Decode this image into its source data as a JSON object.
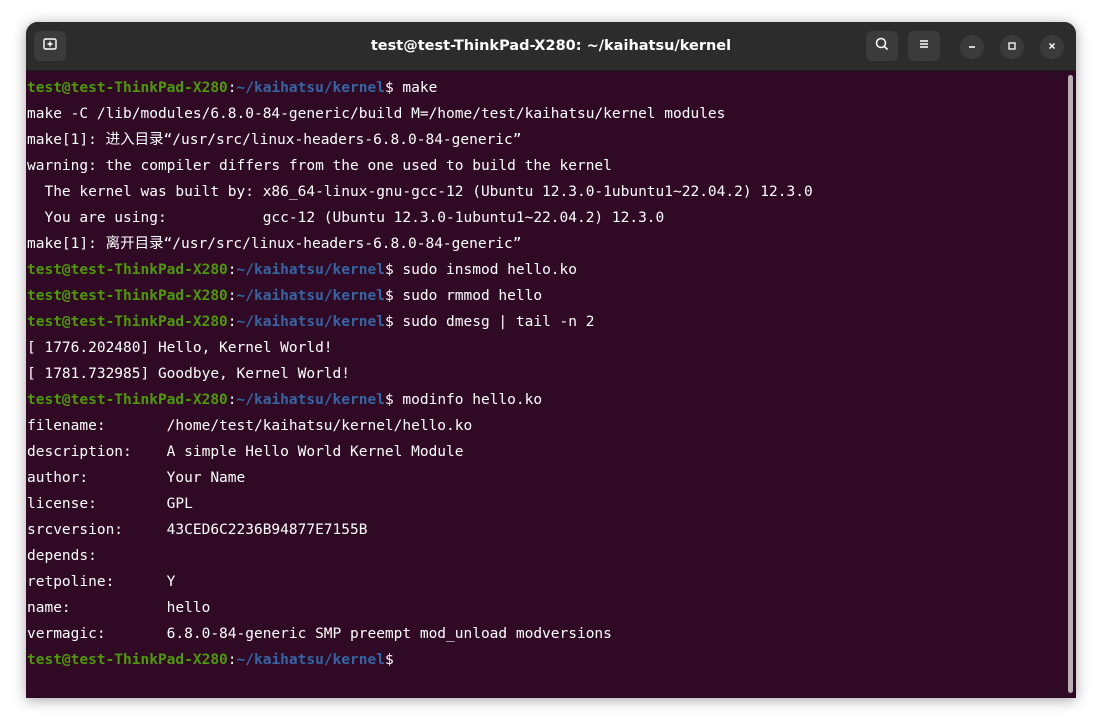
{
  "window": {
    "title": "test@test-ThinkPad-X280: ~/kaihatsu/kernel"
  },
  "titlebar": {
    "new_tab_icon": "new-tab-icon",
    "search_icon": "search-icon",
    "menu_icon": "hamburger-menu-icon",
    "minimize_icon": "minimize-icon",
    "maximize_icon": "maximize-icon",
    "close_icon": "close-icon"
  },
  "colors": {
    "terminal_bg": "#300a24",
    "prompt_user": "#4e9a06",
    "prompt_path": "#3465a4",
    "titlebar_bg": "#2c2c2c"
  },
  "terminal": {
    "prompt": {
      "user": "test@test-ThinkPad-X280",
      "colon": ":",
      "path": "~/kaihatsu/kernel",
      "dollar": "$ "
    },
    "lines": [
      {
        "type": "prompt",
        "cmd": "make"
      },
      {
        "type": "out",
        "text": "make -C /lib/modules/6.8.0-84-generic/build M=/home/test/kaihatsu/kernel modules"
      },
      {
        "type": "out",
        "text": "make[1]: 进入目录“/usr/src/linux-headers-6.8.0-84-generic”"
      },
      {
        "type": "out",
        "text": "warning: the compiler differs from the one used to build the kernel"
      },
      {
        "type": "out",
        "text": "  The kernel was built by: x86_64-linux-gnu-gcc-12 (Ubuntu 12.3.0-1ubuntu1~22.04.2) 12.3.0"
      },
      {
        "type": "out",
        "text": "  You are using:           gcc-12 (Ubuntu 12.3.0-1ubuntu1~22.04.2) 12.3.0"
      },
      {
        "type": "out",
        "text": "make[1]: 离开目录“/usr/src/linux-headers-6.8.0-84-generic”"
      },
      {
        "type": "prompt",
        "cmd": "sudo insmod hello.ko"
      },
      {
        "type": "prompt",
        "cmd": "sudo rmmod hello"
      },
      {
        "type": "prompt",
        "cmd": "sudo dmesg | tail -n 2"
      },
      {
        "type": "out",
        "text": "[ 1776.202480] Hello, Kernel World!"
      },
      {
        "type": "out",
        "text": "[ 1781.732985] Goodbye, Kernel World!"
      },
      {
        "type": "prompt",
        "cmd": "modinfo hello.ko"
      },
      {
        "type": "out",
        "text": "filename:       /home/test/kaihatsu/kernel/hello.ko"
      },
      {
        "type": "out",
        "text": "description:    A simple Hello World Kernel Module"
      },
      {
        "type": "out",
        "text": "author:         Your Name"
      },
      {
        "type": "out",
        "text": "license:        GPL"
      },
      {
        "type": "out",
        "text": "srcversion:     43CED6C2236B94877E7155B"
      },
      {
        "type": "out",
        "text": "depends:        "
      },
      {
        "type": "out",
        "text": "retpoline:      Y"
      },
      {
        "type": "out",
        "text": "name:           hello"
      },
      {
        "type": "out",
        "text": "vermagic:       6.8.0-84-generic SMP preempt mod_unload modversions"
      },
      {
        "type": "prompt",
        "cmd": ""
      }
    ]
  }
}
